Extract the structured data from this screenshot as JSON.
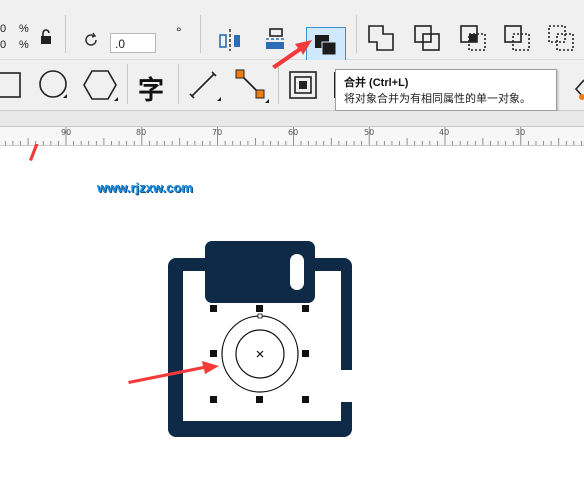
{
  "property_bar": {
    "percent_1": "%",
    "percent_2": "%",
    "digit_1": "0",
    "digit_2": "0",
    "rotation_value": ".0",
    "degree_symbol": "°"
  },
  "tool_bar": {
    "text_tool_glyph": "字"
  },
  "tooltip": {
    "title": "合并 (Ctrl+L)",
    "description": "将对象合并为有相同属性的单一对象。"
  },
  "ruler": {
    "labels": [
      "90",
      "80",
      "70",
      "60",
      "50",
      "40",
      "30"
    ]
  },
  "canvas": {
    "watermark": "www.rjzxw.com",
    "colors": {
      "shape": "#0e2a47",
      "arrow": "#f23a3a",
      "highlight": "#3a91d6"
    }
  }
}
